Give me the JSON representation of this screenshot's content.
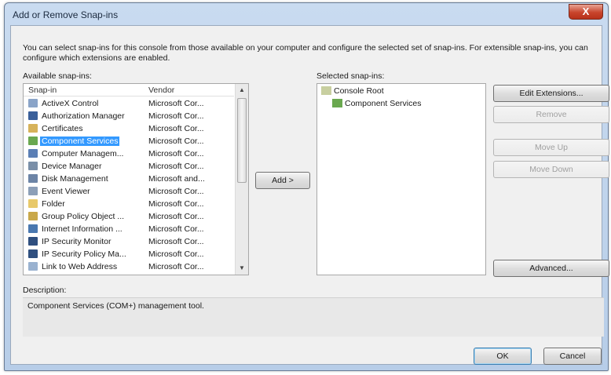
{
  "window": {
    "title": "Add or Remove Snap-ins",
    "close_glyph": "X"
  },
  "intro_text": "You can select snap-ins for this console from those available on your computer and configure the selected set of snap-ins. For extensible snap-ins, you can configure which extensions are enabled.",
  "available": {
    "label": "Available snap-ins:",
    "columns": {
      "snapin": "Snap-in",
      "vendor": "Vendor"
    },
    "rows": [
      {
        "name": "ActiveX Control",
        "vendor": "Microsoft Cor...",
        "icon": "activex-icon",
        "color": "#8aa4c8"
      },
      {
        "name": "Authorization Manager",
        "vendor": "Microsoft Cor...",
        "icon": "authorization-icon",
        "color": "#3a5f9a"
      },
      {
        "name": "Certificates",
        "vendor": "Microsoft Cor...",
        "icon": "certificate-icon",
        "color": "#d6b25a"
      },
      {
        "name": "Component Services",
        "vendor": "Microsoft Cor...",
        "icon": "component-services-icon",
        "color": "#6aa84f"
      },
      {
        "name": "Computer Managem...",
        "vendor": "Microsoft Cor...",
        "icon": "computer-management-icon",
        "color": "#5b7fb5"
      },
      {
        "name": "Device Manager",
        "vendor": "Microsoft Cor...",
        "icon": "device-manager-icon",
        "color": "#7a8fa8"
      },
      {
        "name": "Disk Management",
        "vendor": "Microsoft and...",
        "icon": "disk-management-icon",
        "color": "#6c84a6"
      },
      {
        "name": "Event Viewer",
        "vendor": "Microsoft Cor...",
        "icon": "event-viewer-icon",
        "color": "#8c9fb8"
      },
      {
        "name": "Folder",
        "vendor": "Microsoft Cor...",
        "icon": "folder-icon",
        "color": "#e8c96a"
      },
      {
        "name": "Group Policy Object ...",
        "vendor": "Microsoft Cor...",
        "icon": "group-policy-icon",
        "color": "#c9a84a"
      },
      {
        "name": "Internet Information ...",
        "vendor": "Microsoft Cor...",
        "icon": "iis-icon",
        "color": "#4a78b0"
      },
      {
        "name": "IP Security Monitor",
        "vendor": "Microsoft Cor...",
        "icon": "ip-security-monitor-icon",
        "color": "#2f4f7f"
      },
      {
        "name": "IP Security Policy Ma...",
        "vendor": "Microsoft Cor...",
        "icon": "ip-security-policy-icon",
        "color": "#2f4f7f"
      },
      {
        "name": "Link to Web Address",
        "vendor": "Microsoft Cor...",
        "icon": "web-link-icon",
        "color": "#9ab2d0"
      }
    ],
    "selected_index": 3
  },
  "add_button": "Add >",
  "selected": {
    "label": "Selected snap-ins:",
    "tree": [
      {
        "name": "Console Root",
        "icon": "console-root-folder-icon",
        "color": "#c8cfa0",
        "indent": 0
      },
      {
        "name": "Component Services",
        "icon": "component-services-icon",
        "color": "#6aa84f",
        "indent": 1
      }
    ]
  },
  "side_buttons": {
    "edit_extensions": "Edit Extensions...",
    "remove": "Remove",
    "move_up": "Move Up",
    "move_down": "Move Down",
    "advanced": "Advanced..."
  },
  "description": {
    "label": "Description:",
    "text": "Component Services (COM+) management tool."
  },
  "footer": {
    "ok": "OK",
    "cancel": "Cancel"
  },
  "colors": {
    "selection": "#3399ff",
    "title_bar": "#c9dbf0",
    "close_button": "#c8442c"
  }
}
